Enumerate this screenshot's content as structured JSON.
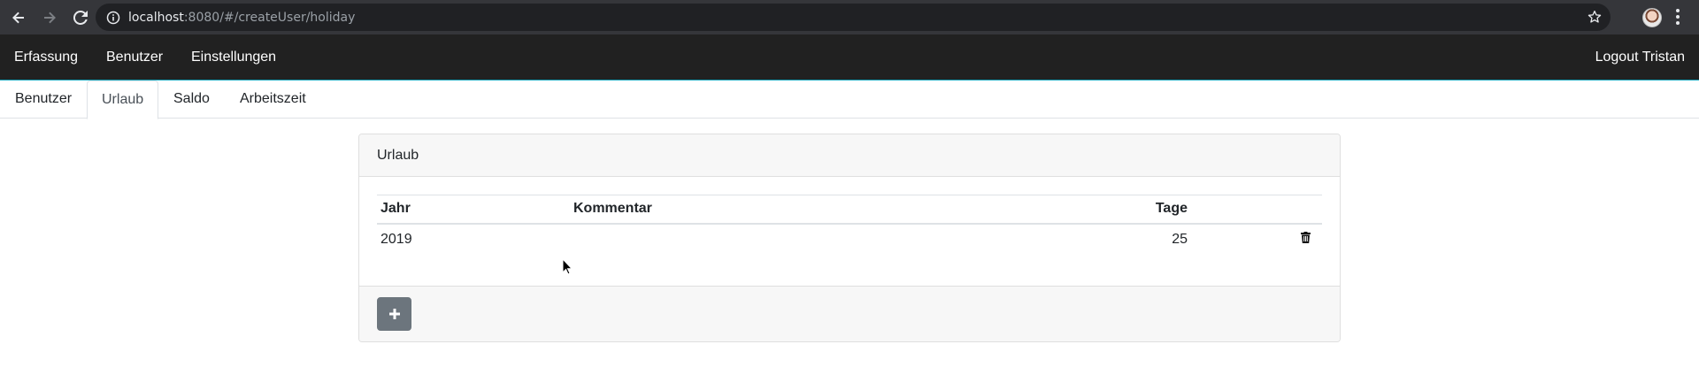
{
  "browser": {
    "url_host": "localhost",
    "url_rest": ":8080/#/createUser/holiday",
    "icons": [
      "back-icon",
      "forward-icon",
      "reload-icon",
      "info-icon",
      "star-icon",
      "kebab-menu-icon"
    ]
  },
  "navbar": {
    "items": [
      {
        "label": "Erfassung"
      },
      {
        "label": "Benutzer"
      },
      {
        "label": "Einstellungen"
      }
    ],
    "logout_label": "Logout Tristan",
    "accent_color": "#17a2b8"
  },
  "tabs": [
    {
      "label": "Benutzer",
      "active": false
    },
    {
      "label": "Urlaub",
      "active": true
    },
    {
      "label": "Saldo",
      "active": false
    },
    {
      "label": "Arbeitszeit",
      "active": false
    }
  ],
  "card": {
    "title": "Urlaub",
    "table": {
      "headers": [
        "Jahr",
        "Kommentar",
        "Tage"
      ],
      "rows": [
        {
          "jahr": "2019",
          "kommentar": "",
          "tage": "25"
        }
      ]
    },
    "add_button_icon": "plus-icon",
    "row_action_icon": "trash-icon"
  }
}
